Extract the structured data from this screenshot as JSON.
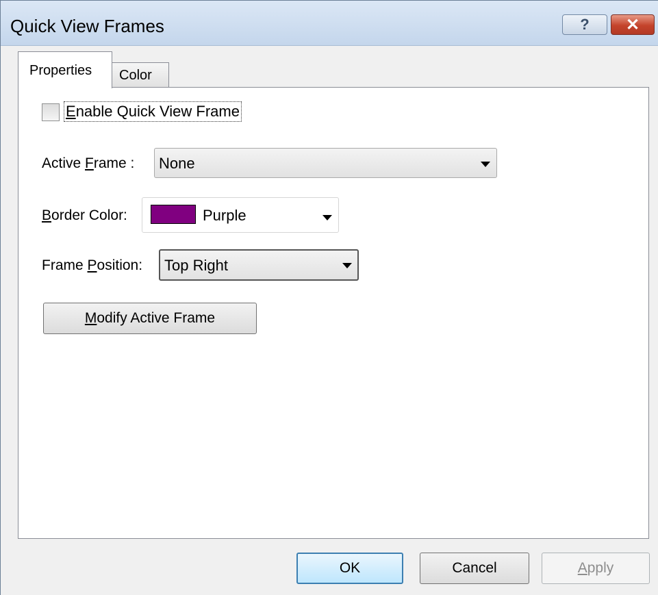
{
  "window": {
    "title": "Quick View Frames"
  },
  "titlebar": {
    "help_glyph": "?",
    "close_glyph": "✕"
  },
  "tabs": [
    {
      "label": "Properties"
    },
    {
      "label": "Color"
    }
  ],
  "properties": {
    "enable_checkbox": {
      "label_prefix": "",
      "label_mnemonic": "E",
      "label_rest": "nable Quick View Frame",
      "checked": false
    },
    "active_frame": {
      "label_prefix": "Active ",
      "label_mnemonic": "F",
      "label_rest": "rame :",
      "value": "None"
    },
    "border_color": {
      "label_prefix": "",
      "label_mnemonic": "B",
      "label_rest": "order Color:",
      "value": "Purple",
      "swatch_color": "#800080"
    },
    "frame_position": {
      "label_prefix": "Frame ",
      "label_mnemonic": "P",
      "label_rest": "osition:",
      "value": "Top Right"
    },
    "modify_button": {
      "label_prefix": "",
      "label_mnemonic": "M",
      "label_rest": "odify Active Frame"
    }
  },
  "footer": {
    "ok_label": "OK",
    "cancel_label": "Cancel",
    "apply": {
      "label_prefix": "",
      "label_mnemonic": "A",
      "label_rest": "pply",
      "enabled": false
    }
  }
}
